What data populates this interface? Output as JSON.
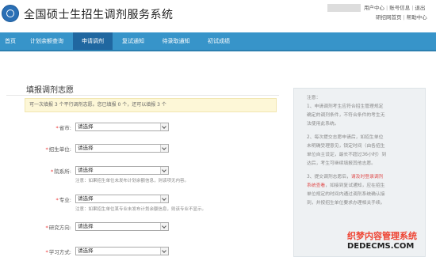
{
  "header": {
    "site_title": "全国硕士生招生调剂服务系统",
    "links_row1": [
      "用户中心",
      "账号信息",
      "退出"
    ],
    "links_row2": [
      "研招网首页",
      "帮助中心"
    ]
  },
  "nav": {
    "items": [
      {
        "label": "首页"
      },
      {
        "label": "计划余额查询"
      },
      {
        "label": "申请调剂"
      },
      {
        "label": "复试通知"
      },
      {
        "label": "待录取通知"
      },
      {
        "label": "初试成绩"
      }
    ],
    "active_index": 2
  },
  "form": {
    "title": "填报调剂志愿",
    "notice": "可一次填报 3 个平行调剂志愿。您已填报 0 个，还可以填报 3 个",
    "fields": [
      {
        "label": "省市:",
        "value": "请选择"
      },
      {
        "label": "招生单位:",
        "value": "请选择"
      },
      {
        "label": "院系所:",
        "value": "请选择",
        "hint": "注意：如果招生单位未发布计划余额信息，则该项无内容。"
      },
      {
        "label": "专业:",
        "value": "请选择",
        "hint": "注意：如果招生单位某专业未发布计划余额信息，则该专业不显示。"
      },
      {
        "label": "研究方向:",
        "value": "请选择"
      },
      {
        "label": "学习方式:",
        "value": "请选择"
      }
    ]
  },
  "sidebar": {
    "lines": [
      [
        {
          "t": "注意："
        }
      ],
      [
        {
          "t": "1、申请调剂考生应符合招生管理规定"
        }
      ],
      [
        {
          "t": "确定的调剂条件，不符合条件的考生无"
        }
      ],
      [
        {
          "t": "法使用此系统。"
        }
      ],
      [
        {
          "t": "2、每次提交志愿申请后，如招生单位"
        }
      ],
      [
        {
          "t": "未明确受理意见，锁定时间（由各招生"
        }
      ],
      [
        {
          "t": "单位自主设定，最长不超过36小时）到"
        }
      ],
      [
        {
          "t": "达后，考生可继续填报其他志愿。"
        }
      ],
      [
        {
          "t": "3、提交调剂志愿后，"
        },
        {
          "t": "请及时登录调剂",
          "red": true
        }
      ],
      [
        {
          "t": "系统查看",
          "red": true
        },
        {
          "t": "，如接到复试通知，应在招生"
        }
      ],
      [
        {
          "t": "单位规定的时间内通过调剂系统确认接"
        }
      ],
      [
        {
          "t": "到，并按招生单位要求办理相关手续。"
        }
      ]
    ]
  },
  "watermark": {
    "line1": "织梦内容管理系统",
    "line2": "DEDECMS.COM"
  },
  "colors": {
    "nav_bg": "#3794c9",
    "nav_active": "#2067a0",
    "notice_bg": "#fdf7d7",
    "required": "#e33333",
    "sidebar_bg": "#eef1f3"
  }
}
